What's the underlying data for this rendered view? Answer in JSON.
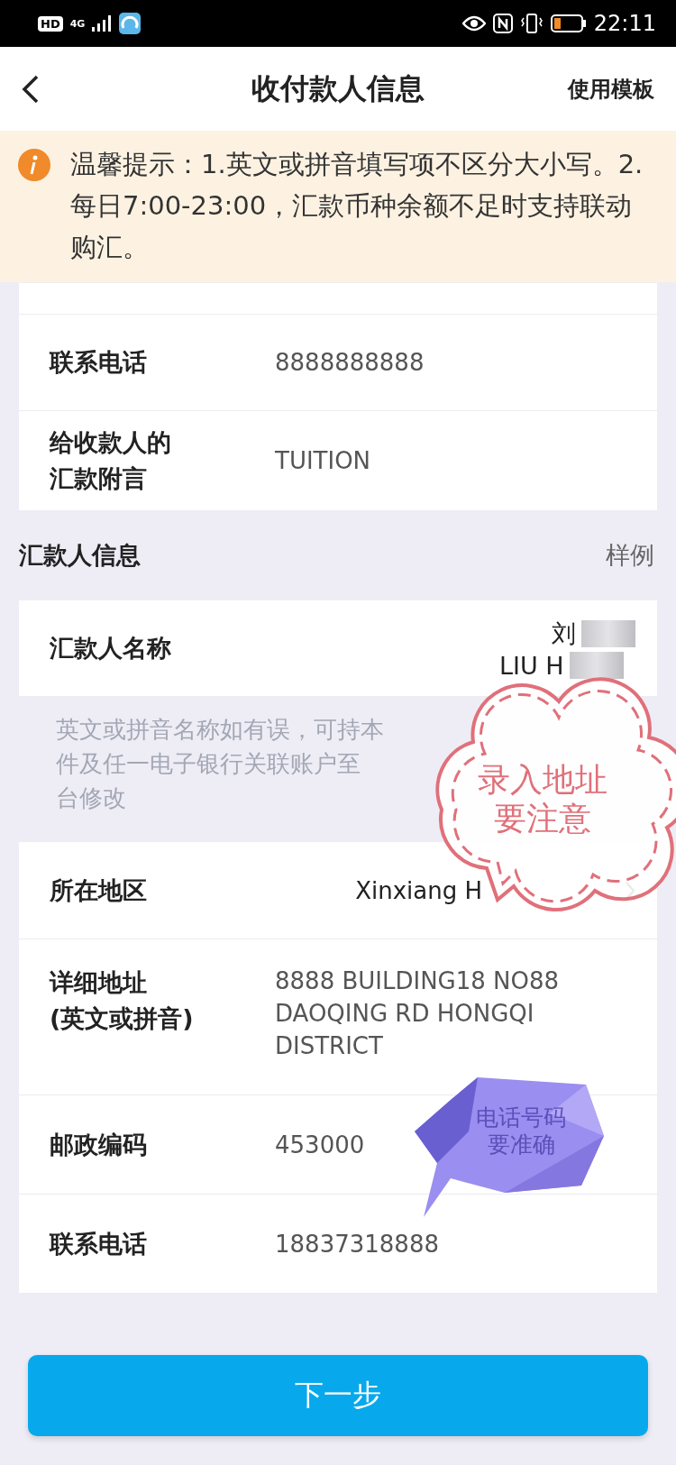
{
  "status_bar": {
    "badges": [
      "HD",
      "4G"
    ],
    "time": "22:11"
  },
  "header": {
    "title": "收付款人信息",
    "action": "使用模板"
  },
  "notice": {
    "text": "温馨提示：1.英文或拼音填写项不区分大小写。2.每日7:00-23:00，汇款币种余额不足时支持联动购汇。"
  },
  "payee_rows": [
    {
      "label": "联系电话",
      "value": "8888888888"
    },
    {
      "label": "给收款人的汇款附言",
      "value": "TUITION"
    }
  ],
  "remitter_section": {
    "title": "汇款人信息",
    "link": "样例"
  },
  "remitter_name": {
    "label": "汇款人名称",
    "values": [
      "刘",
      "LIU H"
    ]
  },
  "name_note": [
    "英文或拼音名称如有误，可持本",
    "件及任一电子银行关联账户至",
    "台修改"
  ],
  "remitter_rows": [
    {
      "kind": "picker",
      "label": "所在地区",
      "value": "Xinxiang H"
    },
    {
      "kind": "text",
      "label": "详细地址\n(英文或拼音)",
      "value": "8888 BUILDING18 NO88 DAOQING RD HONGQI DISTRICT"
    },
    {
      "kind": "text",
      "label": "邮政编码",
      "value": "453000"
    },
    {
      "kind": "text",
      "label": "联系电话",
      "value": "18837318888"
    }
  ],
  "next_button": "下一步",
  "stickers": [
    {
      "kind": "cloud",
      "lines": [
        "录入地址",
        "要注意"
      ]
    },
    {
      "kind": "gem",
      "lines": [
        "电话号码",
        "要准确"
      ]
    }
  ]
}
